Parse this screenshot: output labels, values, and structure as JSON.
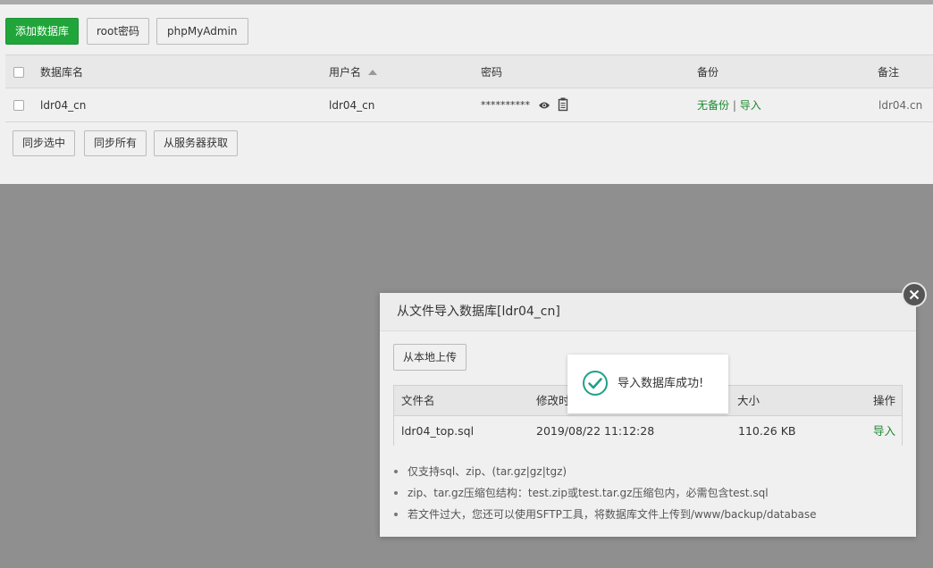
{
  "toolbar": {
    "add_db": "添加数据库",
    "root_pwd": "root密码",
    "phpmyadmin": "phpMyAdmin"
  },
  "table": {
    "headers": {
      "name": "数据库名",
      "user": "用户名",
      "password": "密码",
      "backup": "备份",
      "remark": "备注"
    },
    "rows": [
      {
        "name": "ldr04_cn",
        "user": "ldr04_cn",
        "password": "**********",
        "backup_none": "无备份",
        "separator": "|",
        "import": "导入",
        "remark": "ldr04.cn"
      }
    ]
  },
  "bottom_buttons": {
    "sync_selected": "同步选中",
    "sync_all": "同步所有",
    "fetch_server": "从服务器获取"
  },
  "modal": {
    "title": "从文件导入数据库[ldr04_cn]",
    "upload_button": "从本地上传",
    "headers": {
      "filename": "文件名",
      "modified": "修改时",
      "size": "大小",
      "action": "操作"
    },
    "files": [
      {
        "filename": "ldr04_top.sql",
        "modified": "2019/08/22 11:12:28",
        "size": "110.26 KB",
        "action": "导入"
      }
    ],
    "notes": [
      "仅支持sql、zip、(tar.gz|gz|tgz)",
      "zip、tar.gz压缩包结构：test.zip或test.tar.gz压缩包内，必需包含test.sql",
      "若文件过大，您还可以使用SFTP工具，将数据库文件上传到/www/backup/database"
    ]
  },
  "toast": {
    "message": "导入数据库成功!"
  },
  "colors": {
    "accent_green": "#20a53a",
    "link_green": "#1b8a2f",
    "toast_check": "#20a08a"
  }
}
